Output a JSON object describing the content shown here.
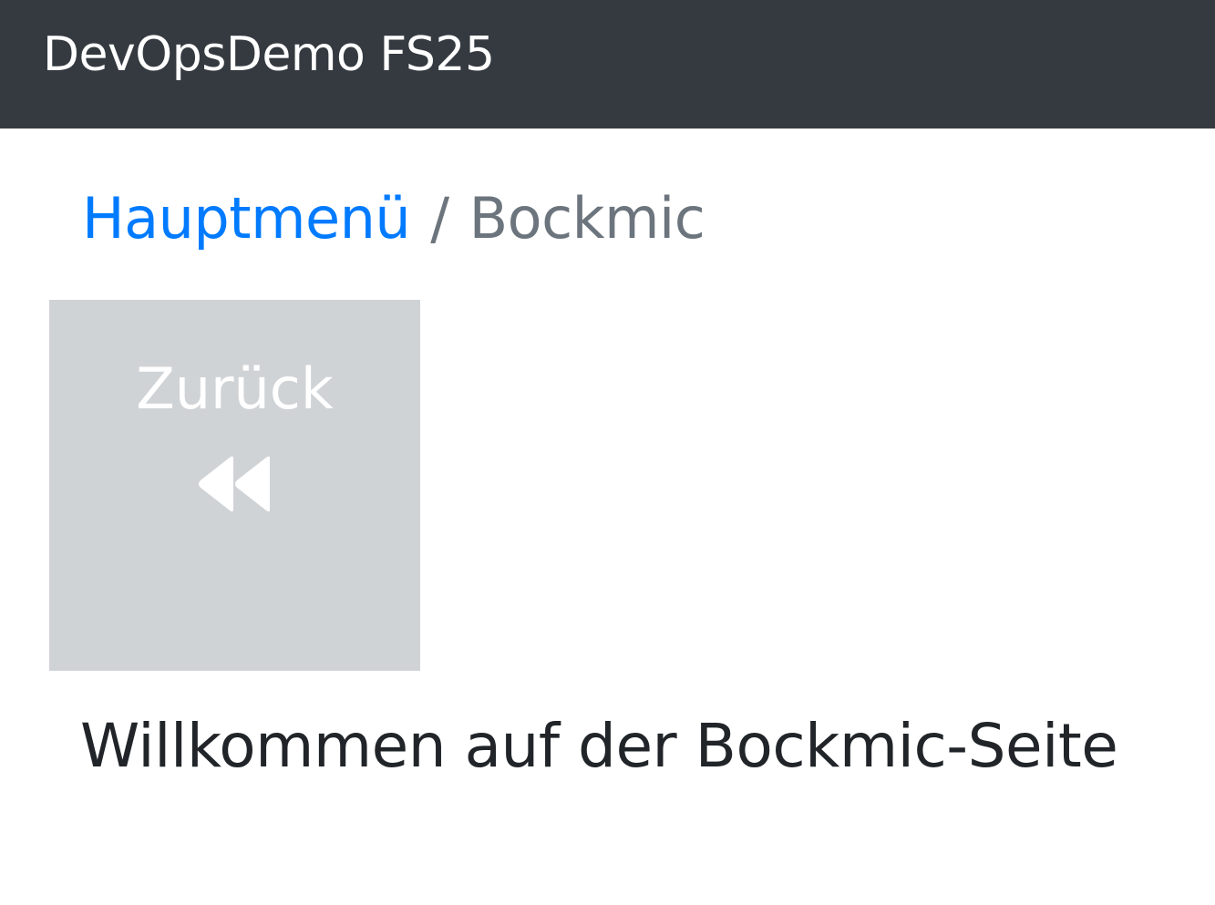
{
  "navbar": {
    "brand": "DevOpsDemo FS25"
  },
  "breadcrumb": {
    "home_label": "Hauptmenü",
    "separator": "/",
    "current_label": "Bockmic"
  },
  "back_tile": {
    "label": "Zurück",
    "icon": "fast-backward-icon"
  },
  "main": {
    "welcome_text": "Willkommen auf der Bockmic-Seite"
  },
  "colors": {
    "navbar_bg": "#343a40",
    "link": "#007bff",
    "muted": "#6c757d",
    "tile_bg": "#d0d3d6",
    "text": "#212529"
  }
}
